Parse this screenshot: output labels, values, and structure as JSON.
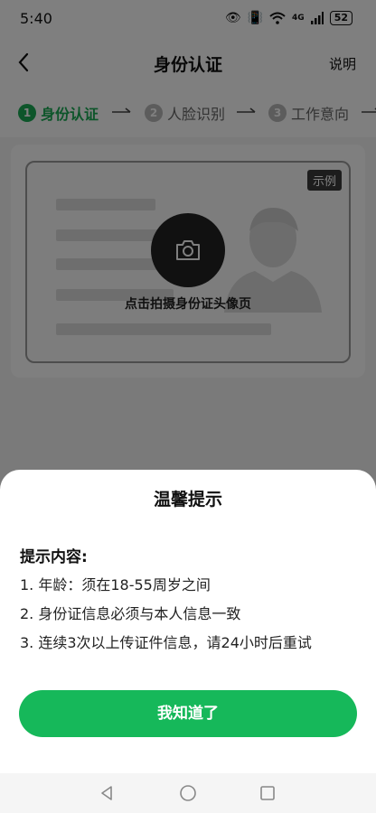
{
  "status_bar": {
    "time": "5:40",
    "network": "4G",
    "battery": "52"
  },
  "nav": {
    "title": "身份认证",
    "help": "说明"
  },
  "steps": [
    {
      "num": "1",
      "label": "身份认证",
      "active": true
    },
    {
      "num": "2",
      "label": "人脸识别",
      "active": false
    },
    {
      "num": "3",
      "label": "工作意向",
      "active": false
    }
  ],
  "id_card": {
    "sample_tag": "示例",
    "hint": "点击拍摄身份证头像页"
  },
  "dialog": {
    "title": "温馨提示",
    "heading": "提示内容:",
    "tips": [
      "1. 年龄：须在18-55周岁之间",
      "2. 身份证信息必须与本人信息一致",
      "3. 连续3次以上传证件信息，请24小时后重试"
    ],
    "confirm_label": "我知道了"
  },
  "colors": {
    "accent": "#16b85a",
    "step_active": "#1aaa55"
  }
}
